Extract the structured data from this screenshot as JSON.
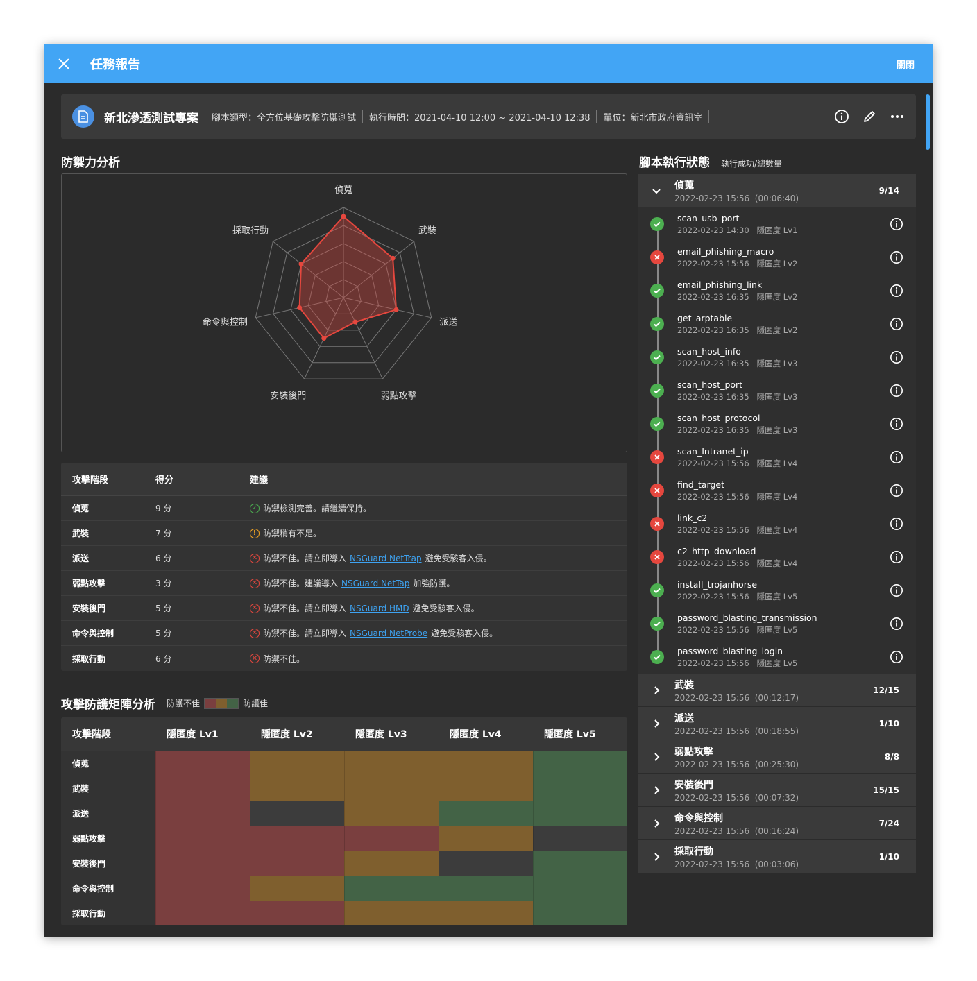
{
  "window": {
    "title": "任務報告",
    "close_label": "關閉"
  },
  "info": {
    "project": "新北滲透測試專案",
    "script_type": "腳本類型：全方位基礎攻擊防禦測試",
    "exec_time": "執行時間：2021-04-10 12:00 ~ 2021-04-10 12:38",
    "unit": "單位：新北市政府資訊室"
  },
  "radar": {
    "title": "防禦力分析",
    "axes": [
      "偵蒐",
      "武裝",
      "派送",
      "弱點攻擊",
      "安裝後門",
      "命令與控制",
      "採取行動"
    ],
    "values": [
      9,
      7,
      6,
      3,
      5,
      5,
      6
    ],
    "max": 10,
    "colors": {
      "line": "#e5473e",
      "fill": "rgba(229,71,62,0.35)",
      "grid": "#777"
    }
  },
  "score_table": {
    "headers": [
      "攻擊階段",
      "得分",
      "建議"
    ],
    "rows": [
      {
        "stage": "偵蒐",
        "score": "9 分",
        "status": "good",
        "pre": "防禦檢測完善。請繼續保持。",
        "link": "",
        "post": ""
      },
      {
        "stage": "武裝",
        "score": "7 分",
        "status": "warn",
        "pre": "防禦稍有不足。",
        "link": "",
        "post": ""
      },
      {
        "stage": "派送",
        "score": "6 分",
        "status": "bad",
        "pre": "防禦不佳。請立即導入 ",
        "link": "NSGuard NetTrap",
        "post": " 避免受駭客入侵。"
      },
      {
        "stage": "弱點攻擊",
        "score": "3 分",
        "status": "bad",
        "pre": "防禦不佳。建議導入 ",
        "link": "NSGuard NetTap",
        "post": " 加強防護。"
      },
      {
        "stage": "安裝後門",
        "score": "5 分",
        "status": "bad",
        "pre": "防禦不佳。請立即導入 ",
        "link": "NSGuard HMD",
        "post": " 避免受駭客入侵。"
      },
      {
        "stage": "命令與控制",
        "score": "5 分",
        "status": "bad",
        "pre": "防禦不佳。請立即導入 ",
        "link": "NSGuard NetProbe",
        "post": " 避免受駭客入侵。"
      },
      {
        "stage": "採取行動",
        "score": "6 分",
        "status": "bad",
        "pre": "防禦不佳。",
        "link": "",
        "post": ""
      }
    ]
  },
  "matrix": {
    "title": "攻擊防護矩陣分析",
    "legend_bad": "防護不佳",
    "legend_good": "防護佳",
    "colors": {
      "bad": "#7a3f3f",
      "mid": "#7f5f2e",
      "good": "#436346",
      "none": "#3c3c3c"
    },
    "headers": [
      "攻擊階段",
      "隱匿度 Lv1",
      "隱匿度 Lv2",
      "隱匿度 Lv3",
      "隱匿度 Lv4",
      "隱匿度 Lv5"
    ],
    "rows": [
      {
        "stage": "偵蒐",
        "cells": [
          "bad",
          "mid",
          "mid",
          "mid",
          "good"
        ]
      },
      {
        "stage": "武裝",
        "cells": [
          "bad",
          "mid",
          "mid",
          "mid",
          "good"
        ]
      },
      {
        "stage": "派送",
        "cells": [
          "bad",
          "none",
          "mid",
          "good",
          "good"
        ]
      },
      {
        "stage": "弱點攻擊",
        "cells": [
          "bad",
          "bad",
          "bad",
          "mid",
          "none"
        ]
      },
      {
        "stage": "安裝後門",
        "cells": [
          "bad",
          "bad",
          "mid",
          "none",
          "good"
        ]
      },
      {
        "stage": "命令與控制",
        "cells": [
          "bad",
          "mid",
          "good",
          "good",
          "good"
        ]
      },
      {
        "stage": "採取行動",
        "cells": [
          "bad",
          "bad",
          "mid",
          "mid",
          "good"
        ]
      }
    ]
  },
  "scripts": {
    "title": "腳本執行狀態",
    "subtitle": "執行成功/總數量",
    "expanded": {
      "name": "偵蒐",
      "time": "2022-02-23 15:56",
      "duration": "(00:06:40)",
      "count": "9/14",
      "items": [
        {
          "name": "scan_usb_port",
          "time": "2022-02-23 14:30",
          "level": "隱匿度 Lv1",
          "ok": true
        },
        {
          "name": "email_phishing_macro",
          "time": "2022-02-23 15:56",
          "level": "隱匿度 Lv2",
          "ok": false
        },
        {
          "name": "email_phishing_link",
          "time": "2022-02-23 16:35",
          "level": "隱匿度 Lv2",
          "ok": true
        },
        {
          "name": "get_arptable",
          "time": "2022-02-23 16:35",
          "level": "隱匿度 Lv2",
          "ok": true
        },
        {
          "name": "scan_host_info",
          "time": "2022-02-23 16:35",
          "level": "隱匿度 Lv3",
          "ok": true
        },
        {
          "name": "scan_host_port",
          "time": "2022-02-23 16:35",
          "level": "隱匿度 Lv3",
          "ok": true
        },
        {
          "name": "scan_host_protocol",
          "time": "2022-02-23 16:35",
          "level": "隱匿度 Lv3",
          "ok": true
        },
        {
          "name": "scan_Intranet_ip",
          "time": "2022-02-23 15:56",
          "level": "隱匿度 Lv4",
          "ok": false
        },
        {
          "name": "find_target",
          "time": "2022-02-23 15:56",
          "level": "隱匿度 Lv4",
          "ok": false
        },
        {
          "name": "link_c2",
          "time": "2022-02-23 15:56",
          "level": "隱匿度 Lv4",
          "ok": false
        },
        {
          "name": "c2_http_download",
          "time": "2022-02-23 15:56",
          "level": "隱匿度 Lv4",
          "ok": false
        },
        {
          "name": "install_trojanhorse",
          "time": "2022-02-23 15:56",
          "level": "隱匿度 Lv5",
          "ok": true
        },
        {
          "name": "password_blasting_transmission",
          "time": "2022-02-23 15:56",
          "level": "隱匿度 Lv5",
          "ok": true
        },
        {
          "name": "password_blasting_login",
          "time": "2022-02-23 15:56",
          "level": "隱匿度 Lv5",
          "ok": true
        }
      ]
    },
    "collapsed": [
      {
        "name": "武裝",
        "time": "2022-02-23 15:56",
        "duration": "(00:12:17)",
        "count": "12/15"
      },
      {
        "name": "派送",
        "time": "2022-02-23 15:56",
        "duration": "(00:18:55)",
        "count": "1/10"
      },
      {
        "name": "弱點攻擊",
        "time": "2022-02-23 15:56",
        "duration": "(00:25:30)",
        "count": "8/8"
      },
      {
        "name": "安裝後門",
        "time": "2022-02-23 15:56",
        "duration": "(00:07:32)",
        "count": "15/15"
      },
      {
        "name": "命令與控制",
        "time": "2022-02-23 15:56",
        "duration": "(00:16:24)",
        "count": "7/24"
      },
      {
        "name": "採取行動",
        "time": "2022-02-23 15:56",
        "duration": "(00:03:06)",
        "count": "1/10"
      }
    ]
  }
}
